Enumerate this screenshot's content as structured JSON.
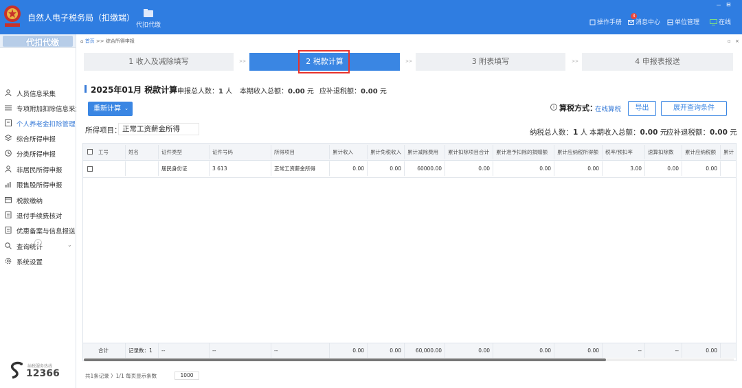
{
  "app": {
    "title": "自然人电子税务局（扣缴端）",
    "nav": [
      {
        "label": "代扣代缴",
        "icon": "folder-icon"
      }
    ],
    "window_controls": [
      "－",
      "⊟"
    ],
    "header_links": [
      {
        "label": "操作手册",
        "icon": "manual-icon"
      },
      {
        "label": "消息中心",
        "icon": "mail-icon",
        "badge": "3"
      },
      {
        "label": "单位管理",
        "icon": "unit-icon"
      },
      {
        "label": "在线",
        "icon": "online-icon"
      }
    ],
    "colors": {
      "primary": "#2f7de1",
      "accent": "#3a86e3",
      "highlight": "#e8322b"
    }
  },
  "sidebar": {
    "header": "代扣代缴",
    "items": [
      {
        "label": "人员信息采集",
        "icon": "person-icon",
        "active": false
      },
      {
        "label": "专项附加扣除信息采集",
        "icon": "list-icon",
        "active": false
      },
      {
        "label": "个人养老金扣除管理",
        "icon": "pension-icon",
        "active": true
      },
      {
        "label": "综合所得申报",
        "icon": "layers-icon",
        "active": false
      },
      {
        "label": "分类所得申报",
        "icon": "clock-icon",
        "active": false
      },
      {
        "label": "非居民所得申报",
        "icon": "person-icon",
        "active": false
      },
      {
        "label": "限售股所得申报",
        "icon": "chart-icon",
        "active": false
      },
      {
        "label": "税款缴纳",
        "icon": "wallet-icon",
        "active": false
      },
      {
        "label": "退付手续费核对",
        "icon": "document-icon",
        "active": false
      },
      {
        "label": "优惠备案与信息报送",
        "icon": "document-icon",
        "active": false,
        "expandable": true
      },
      {
        "label": "查询统计",
        "icon": "search-icon",
        "active": false,
        "expandable": true
      },
      {
        "label": "系统设置",
        "icon": "gear-icon",
        "active": false
      }
    ],
    "collapse": "«",
    "hotline_label": "纳税服务热线",
    "hotline": "12366"
  },
  "breadcrumb": {
    "home": "首页",
    "sep": ">>",
    "current": "综合所得申报"
  },
  "page_controls": [
    "▫",
    "×"
  ],
  "steps": [
    {
      "label": "1 收入及减除填写",
      "active": false
    },
    {
      "label": "2 税款计算",
      "active": true
    },
    {
      "label": "3 附表填写",
      "active": false
    },
    {
      "label": "4 申报表报送",
      "active": false
    }
  ],
  "step_sep": ">>",
  "summary": {
    "title": "2025年01月 税款计算",
    "people_label": "申报总人数：",
    "people_value": "1",
    "people_unit": "人",
    "income_label": "本期收入总额：",
    "income_value": "0.00",
    "income_unit": "元",
    "refund_label": "应补退税额：",
    "refund_value": "0.00",
    "refund_unit": "元"
  },
  "actions": {
    "recalc": "重新计算",
    "calc_method_label": "算税方式：",
    "calc_method_value": "在线算税",
    "export": "导出",
    "expand_filter": "展开查询条件"
  },
  "filter": {
    "item_label": "所得项目：",
    "item_value": "正常工资薪金所得"
  },
  "table_summary": {
    "people_label": "纳税总人数：",
    "people_value": "1",
    "people_unit": "人",
    "income_label": "本期收入总额：",
    "income_value": "0.00",
    "income_unit": "元",
    "refund_label": "应补退税额：",
    "refund_value": "0.00",
    "refund_unit": "元"
  },
  "table": {
    "columns": [
      "工号",
      "姓名",
      "证件类型",
      "证件号码",
      "所得项目",
      "累计收入",
      "累计免税收入",
      "累计减除费用",
      "累计扣除项目合计",
      "累计准予扣除的捐赠额",
      "累计应纳税所得额",
      "税率/预扣率",
      "速算扣除数",
      "累计应纳税额",
      "累计"
    ],
    "rows": [
      [
        "",
        "",
        "居民身份证",
        "3                    613",
        "正常工资薪金所得",
        "0.00",
        "0.00",
        "60000.00",
        "0.00",
        "0.00",
        "0.00",
        "3.00",
        "0.00",
        "0.00",
        ""
      ]
    ],
    "footer": [
      "合计",
      "记录数：1",
      "--",
      "--",
      "--",
      "0.00",
      "0.00",
      "60,000.00",
      "0.00",
      "0.00",
      "0.00",
      "--",
      "--",
      "0.00",
      ""
    ]
  },
  "pager": {
    "text": "共1条记录 〉1/1 每页显示条数",
    "size": "1000"
  }
}
